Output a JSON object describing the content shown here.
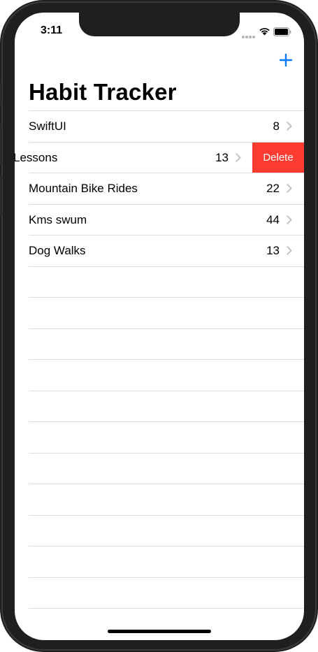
{
  "status_bar": {
    "time": "3:11"
  },
  "nav": {
    "add_icon": "plus-icon",
    "title": "Habit Tracker"
  },
  "habits": [
    {
      "name": "SwiftUI",
      "count": "8"
    },
    {
      "name": "Lessons",
      "count": "13",
      "swiped": true
    },
    {
      "name": "Mountain Bike Rides",
      "count": "22"
    },
    {
      "name": "Kms swum",
      "count": "44"
    },
    {
      "name": "Dog Walks",
      "count": "13"
    }
  ],
  "swipe_action": {
    "label": "Delete"
  },
  "colors": {
    "accent": "#007aff",
    "destructive": "#fe3b30",
    "separator": "#dcdcdc",
    "chevron": "#c4c4c7"
  }
}
